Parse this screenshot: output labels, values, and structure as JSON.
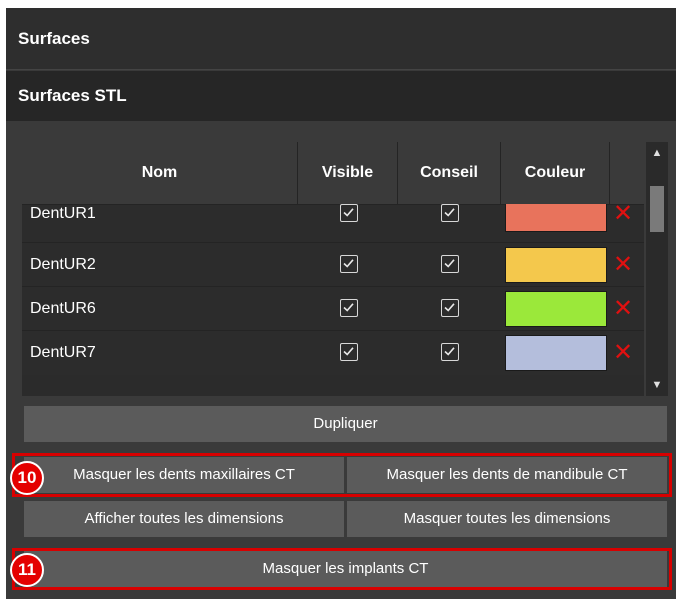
{
  "panel": {
    "title": "Surfaces",
    "section_title": "Surfaces STL"
  },
  "table": {
    "columns": [
      "Nom",
      "Visible",
      "Conseil",
      "Couleur",
      ""
    ],
    "rows": [
      {
        "name": "DentUR1",
        "visible": true,
        "conseil": true,
        "color": "#e8735c"
      },
      {
        "name": "DentUR2",
        "visible": true,
        "conseil": true,
        "color": "#f4c84c"
      },
      {
        "name": "DentUR6",
        "visible": true,
        "conseil": true,
        "color": "#9be83a"
      },
      {
        "name": "DentUR7",
        "visible": true,
        "conseil": true,
        "color": "#b4bedc"
      }
    ],
    "delete_icon": "close-icon",
    "scroll_up_icon": "triangle-up",
    "scroll_down_icon": "triangle-down"
  },
  "buttons": {
    "duplicate": "Dupliquer",
    "hide_maxillary_ct": "Masquer les dents maxillaires CT",
    "hide_mandible_ct": "Masquer les dents de mandibule CT",
    "show_all_dimensions": "Afficher toutes les dimensions",
    "hide_all_dimensions": "Masquer toutes les dimensions",
    "hide_implants_ct": "Masquer les implants CT"
  },
  "annotations": {
    "badge_10": "10",
    "badge_11": "11",
    "highlight_color": "#d80000"
  }
}
